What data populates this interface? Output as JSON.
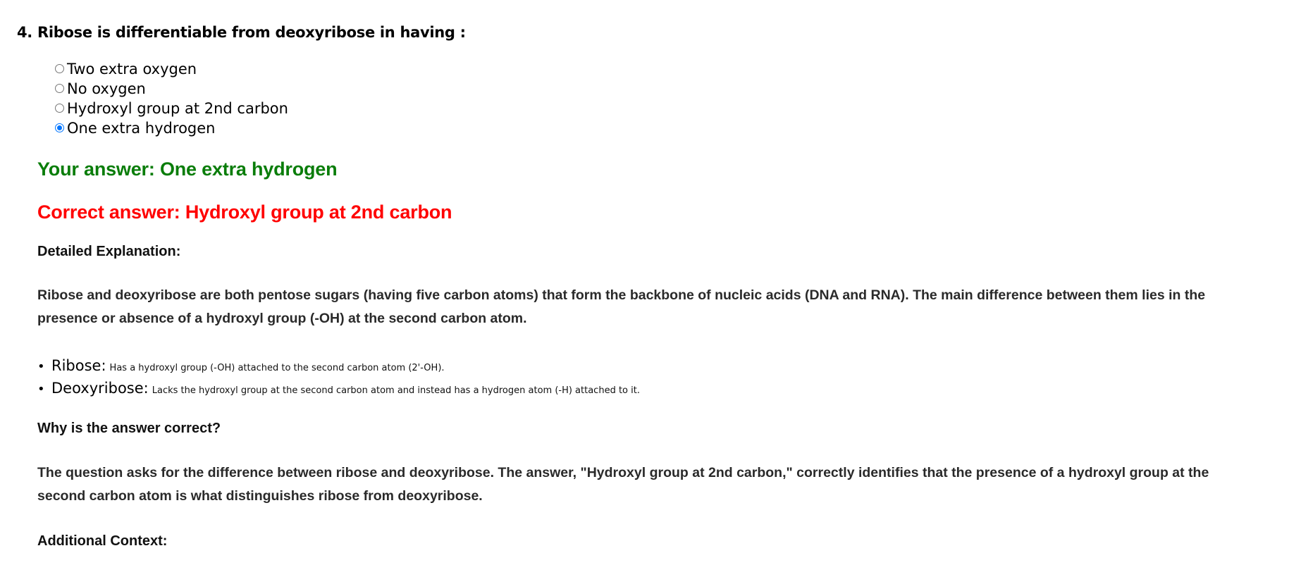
{
  "question": {
    "text": "4. Ribose is differentiable from deoxyribose in having :",
    "options": [
      {
        "label": "Two extra oxygen",
        "selected": false
      },
      {
        "label": "No oxygen",
        "selected": false
      },
      {
        "label": "Hydroxyl group at 2nd carbon",
        "selected": false
      },
      {
        "label": "One extra hydrogen",
        "selected": true
      }
    ]
  },
  "result": {
    "your_answer": "Your answer: One extra hydrogen",
    "correct_answer": "Correct answer: Hydroxyl group at 2nd carbon",
    "your_answer_color": "#0a7d0a",
    "correct_answer_color": "#ff0000"
  },
  "explanation": {
    "heading": "Detailed Explanation:",
    "paragraph": "Ribose and deoxyribose are both pentose sugars (having five carbon atoms) that form the backbone of nucleic acids (DNA and RNA). The main difference between them lies in the presence or absence of a hydroxyl group (-OH) at the second carbon atom.",
    "bullets": [
      {
        "term": "Ribose:",
        "desc": "Has a hydroxyl group (-OH) attached to the second carbon atom (2'-OH)."
      },
      {
        "term": "Deoxyribose:",
        "desc": "Lacks the hydroxyl group at the second carbon atom and instead has a hydrogen atom (-H) attached to it."
      }
    ]
  },
  "why": {
    "heading": "Why is the answer correct?",
    "paragraph": "The question asks for the difference between ribose and deoxyribose. The answer, \"Hydroxyl group at 2nd carbon,\" correctly identifies that the presence of a hydroxyl group at the second carbon atom is what distinguishes ribose from deoxyribose."
  },
  "additional": {
    "heading": "Additional Context:"
  },
  "colors": {
    "radio_accent": "#0075ff",
    "text": "#000000"
  }
}
